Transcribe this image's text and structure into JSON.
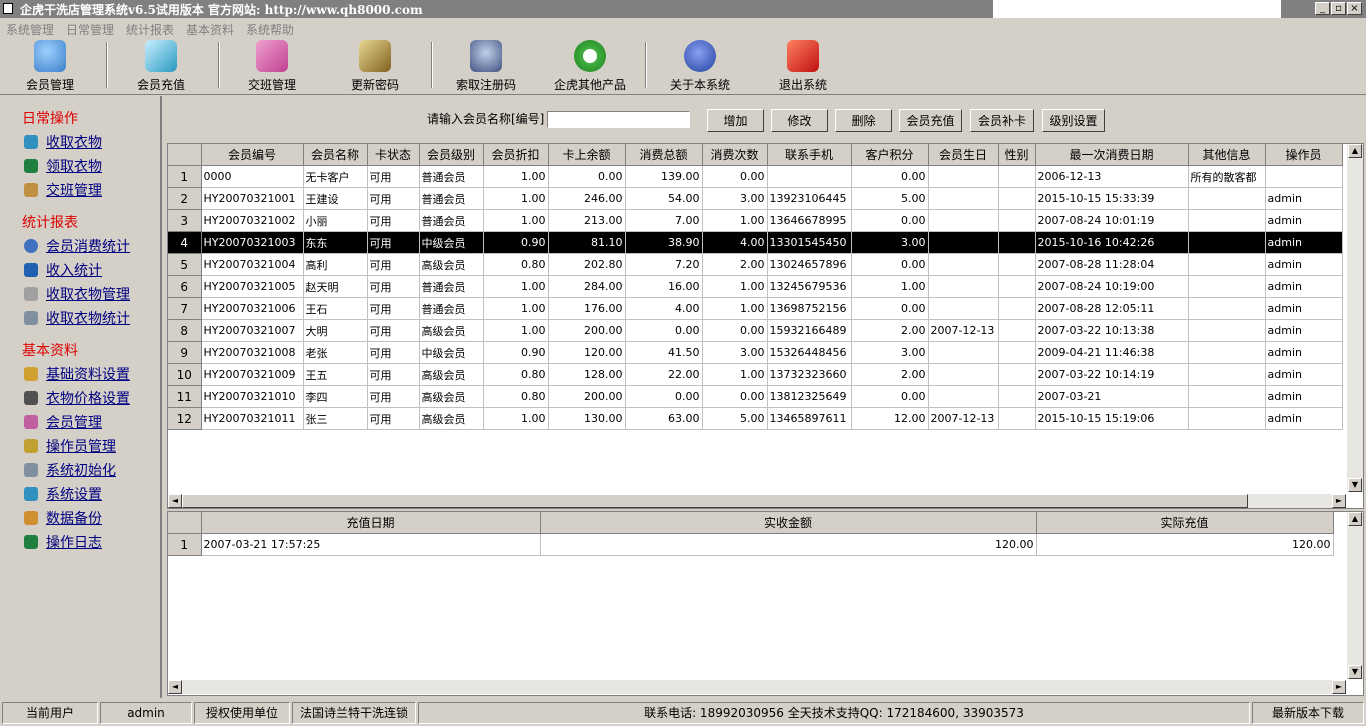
{
  "window": {
    "title": "企虎干洗店管理系统v6.5试用版本 官方网站: http://www.qh8000.com",
    "min_label": "_",
    "max_label": "▫",
    "close_label": "×"
  },
  "menu": [
    "系统管理",
    "日常管理",
    "统计报表",
    "基本资料",
    "系统帮助"
  ],
  "toolbar": [
    {
      "label": "会员管理",
      "icon": "people-icon",
      "color": "#5aa0e0"
    },
    {
      "label": "会员充值",
      "icon": "pen-icon",
      "color": "#3ab0d0"
    },
    {
      "label": "交班管理",
      "icon": "face-icon",
      "color": "#d050a0"
    },
    {
      "label": "更新密码",
      "icon": "key-icon",
      "color": "#c0a040"
    },
    {
      "label": "索取注册码",
      "icon": "register-icon",
      "color": "#5070a0"
    },
    {
      "label": "企虎其他产品",
      "icon": "refresh-icon",
      "color": "#30a030"
    },
    {
      "label": "关于本系统",
      "icon": "mascot-icon",
      "color": "#4060c0"
    },
    {
      "label": "退出系统",
      "icon": "exit-icon",
      "color": "#e03020"
    }
  ],
  "sidebar": {
    "sections": [
      {
        "title": "日常操作",
        "items": [
          {
            "label": "收取衣物",
            "icon": "collect-clothes-icon",
            "color": "#3090c0"
          },
          {
            "label": "领取衣物",
            "icon": "pickup-clothes-icon",
            "color": "#208040"
          },
          {
            "label": "交班管理",
            "icon": "box-icon",
            "color": "#c09040"
          }
        ]
      },
      {
        "title": "统计报表",
        "items": [
          {
            "label": "会员消费统计",
            "icon": "magnifier-icon",
            "color": "#4070c0"
          },
          {
            "label": "收入统计",
            "icon": "chart-icon",
            "color": "#2060b0"
          },
          {
            "label": "收取衣物管理",
            "icon": "manage-icon",
            "color": "#a0a0a0"
          },
          {
            "label": "收取衣物统计",
            "icon": "printer-icon",
            "color": "#8090a0"
          }
        ]
      },
      {
        "title": "基本资料",
        "items": [
          {
            "label": "基础资料设置",
            "icon": "settings-icon",
            "color": "#d0a030"
          },
          {
            "label": "衣物价格设置",
            "icon": "price-icon",
            "color": "#505050"
          },
          {
            "label": "会员管理",
            "icon": "member-icon",
            "color": "#c060a0"
          },
          {
            "label": "操作员管理",
            "icon": "operator-icon",
            "color": "#c0a030"
          },
          {
            "label": "系统初始化",
            "icon": "init-icon",
            "color": "#8090a0"
          },
          {
            "label": "系统设置",
            "icon": "system-icon",
            "color": "#3090c0"
          },
          {
            "label": "数据备份",
            "icon": "backup-icon",
            "color": "#d09030"
          },
          {
            "label": "操作日志",
            "icon": "log-icon",
            "color": "#208040"
          }
        ]
      }
    ]
  },
  "search": {
    "label": "请输入会员名称[编号]",
    "value": ""
  },
  "actions": [
    "增加",
    "修改",
    "删除",
    "会员充值",
    "会员补卡",
    "级别设置"
  ],
  "members_table": {
    "columns": [
      "会员编号",
      "会员名称",
      "卡状态",
      "会员级别",
      "会员折扣",
      "卡上余额",
      "消费总额",
      "消费次数",
      "联系手机",
      "客户积分",
      "会员生日",
      "性别",
      "最一次消费日期",
      "其他信息",
      "操作员"
    ],
    "selected_row": 4,
    "rows": [
      {
        "n": "1",
        "c": [
          "0000",
          "无卡客户",
          "可用",
          "普通会员",
          "1.00",
          "0.00",
          "139.00",
          "0.00",
          "",
          "0.00",
          "",
          "",
          "2006-12-13",
          "所有的散客都",
          ""
        ]
      },
      {
        "n": "2",
        "c": [
          "HY20070321001",
          "王建设",
          "可用",
          "普通会员",
          "1.00",
          "246.00",
          "54.00",
          "3.00",
          "13923106445",
          "5.00",
          "",
          "",
          "2015-10-15 15:33:39",
          "",
          "admin"
        ]
      },
      {
        "n": "3",
        "c": [
          "HY20070321002",
          "小丽",
          "可用",
          "普通会员",
          "1.00",
          "213.00",
          "7.00",
          "1.00",
          "13646678995",
          "0.00",
          "",
          "",
          "2007-08-24 10:01:19",
          "",
          "admin"
        ]
      },
      {
        "n": "4",
        "c": [
          "HY20070321003",
          "东东",
          "可用",
          "中级会员",
          "0.90",
          "81.10",
          "38.90",
          "4.00",
          "13301545450",
          "3.00",
          "",
          "",
          "2015-10-16 10:42:26",
          "",
          "admin"
        ]
      },
      {
        "n": "5",
        "c": [
          "HY20070321004",
          "高利",
          "可用",
          "高级会员",
          "0.80",
          "202.80",
          "7.20",
          "2.00",
          "13024657896",
          "0.00",
          "",
          "",
          "2007-08-28 11:28:04",
          "",
          "admin"
        ]
      },
      {
        "n": "6",
        "c": [
          "HY20070321005",
          "赵天明",
          "可用",
          "普通会员",
          "1.00",
          "284.00",
          "16.00",
          "1.00",
          "13245679536",
          "1.00",
          "",
          "",
          "2007-08-24 10:19:00",
          "",
          "admin"
        ]
      },
      {
        "n": "7",
        "c": [
          "HY20070321006",
          "王石",
          "可用",
          "普通会员",
          "1.00",
          "176.00",
          "4.00",
          "1.00",
          "13698752156",
          "0.00",
          "",
          "",
          "2007-08-28 12:05:11",
          "",
          "admin"
        ]
      },
      {
        "n": "8",
        "c": [
          "HY20070321007",
          "大明",
          "可用",
          "高级会员",
          "1.00",
          "200.00",
          "0.00",
          "0.00",
          "15932166489",
          "2.00",
          "2007-12-13",
          "",
          "2007-03-22 10:13:38",
          "",
          "admin"
        ]
      },
      {
        "n": "9",
        "c": [
          "HY20070321008",
          "老张",
          "可用",
          "中级会员",
          "0.90",
          "120.00",
          "41.50",
          "3.00",
          "15326448456",
          "3.00",
          "",
          "",
          "2009-04-21 11:46:38",
          "",
          "admin"
        ]
      },
      {
        "n": "10",
        "c": [
          "HY20070321009",
          "王五",
          "可用",
          "高级会员",
          "0.80",
          "128.00",
          "22.00",
          "1.00",
          "13732323660",
          "2.00",
          "",
          "",
          "2007-03-22 10:14:19",
          "",
          "admin"
        ]
      },
      {
        "n": "11",
        "c": [
          "HY20070321010",
          "李四",
          "可用",
          "高级会员",
          "0.80",
          "200.00",
          "0.00",
          "0.00",
          "13812325649",
          "0.00",
          "",
          "",
          "2007-03-21",
          "",
          "admin"
        ]
      },
      {
        "n": "12",
        "c": [
          "HY20070321011",
          "张三",
          "可用",
          "高级会员",
          "1.00",
          "130.00",
          "63.00",
          "5.00",
          "13465897611",
          "12.00",
          "2007-12-13",
          "",
          "2015-10-15 15:19:06",
          "",
          "admin"
        ]
      }
    ]
  },
  "recharge_table": {
    "columns": [
      "充值日期",
      "实收金额",
      "实际充值"
    ],
    "rows": [
      {
        "n": "1",
        "c": [
          "2007-03-21 17:57:25",
          "120.00",
          "120.00"
        ]
      }
    ]
  },
  "statusbar": {
    "user_label": "当前用户",
    "user": "admin",
    "licensee_label": "授权使用单位",
    "licensee": "法国诗兰特干洗连锁",
    "contact": "联系电话: 18992030956  全天技术支持QQ: 172184600, 33903573",
    "download": "最新版本下载"
  }
}
